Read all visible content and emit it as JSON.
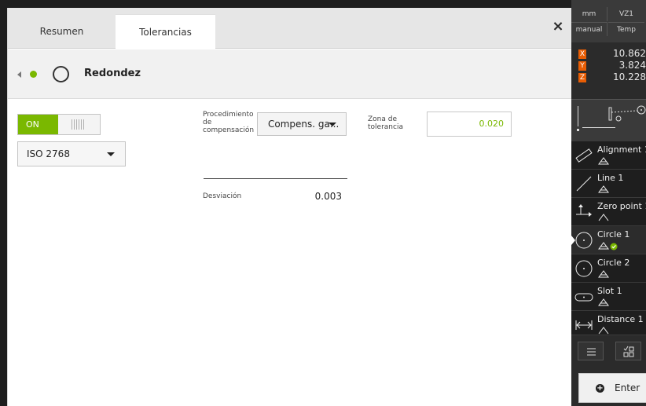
{
  "tabs": {
    "resumen": "Resumen",
    "tolerancias": "Tolerancias",
    "close": "×"
  },
  "feature": {
    "name": "Redondez",
    "status": "ok"
  },
  "toggle": {
    "state": "ON"
  },
  "standard": {
    "selected": "ISO 2768"
  },
  "procedure": {
    "label": "Procedimiento de compensación",
    "selected": "Compens. ga..."
  },
  "zone": {
    "label": "Zona de tolerancia",
    "value": "0.020"
  },
  "deviation": {
    "label": "Desviación",
    "value": "0.003"
  },
  "right_panel": {
    "unit": "mm",
    "vz": "VZ1",
    "mode": "manual",
    "temp": "Temp",
    "coords": [
      {
        "axis": "X",
        "value": "10.862"
      },
      {
        "axis": "Y",
        "value": "3.824"
      },
      {
        "axis": "Z",
        "value": "10.228"
      }
    ],
    "features": [
      {
        "name": "Alignment 1",
        "icon": "alignment-icon"
      },
      {
        "name": "Line 1",
        "icon": "line-icon"
      },
      {
        "name": "Zero point 1",
        "icon": "zero-point-icon"
      },
      {
        "name": "Circle 1",
        "icon": "circle-icon",
        "selected": true,
        "ok": true
      },
      {
        "name": "Circle 2",
        "icon": "circle-icon"
      },
      {
        "name": "Slot 1",
        "icon": "slot-icon"
      },
      {
        "name": "Distance 1",
        "icon": "distance-icon"
      }
    ],
    "enter_label": "Enter"
  },
  "colors": {
    "accent_green": "#7ab800",
    "axis_orange": "#e85d04",
    "panel_dark": "#1e1e1e"
  }
}
